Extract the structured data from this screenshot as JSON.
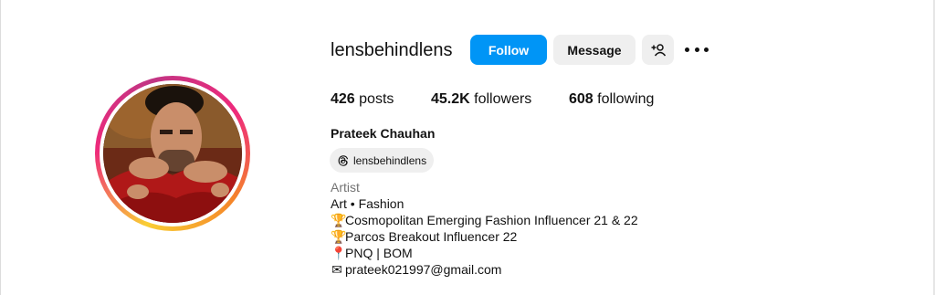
{
  "profile": {
    "username": "lensbehindlens",
    "full_name": "Prateek Chauhan",
    "threads_handle": "lensbehindlens"
  },
  "actions": {
    "follow_label": "Follow",
    "message_label": "Message",
    "suggest_icon": "add-person-icon",
    "more_icon": "more-options-icon"
  },
  "stats": {
    "posts_count": "426",
    "posts_label": "posts",
    "followers_count": "45.2K",
    "followers_label": "followers",
    "following_count": "608",
    "following_label": "following"
  },
  "bio": {
    "category": "Artist",
    "lines": [
      {
        "emoji": "",
        "text": "Art • Fashion"
      },
      {
        "emoji": "🏆",
        "text": "Cosmopolitan Emerging Fashion Influencer 21 & 22"
      },
      {
        "emoji": "🏆",
        "text": "Parcos Breakout Influencer 22"
      },
      {
        "emoji": "📍",
        "text": "PNQ | BOM"
      },
      {
        "emoji": "✉",
        "text": "prateek021997@gmail.com"
      }
    ]
  },
  "colors": {
    "follow_bg": "#0095f6",
    "secondary_bg": "#efefef",
    "category_text": "#737373",
    "ring_start": "#f9ce34",
    "ring_mid": "#ee2a7b",
    "ring_end": "#c13584"
  }
}
